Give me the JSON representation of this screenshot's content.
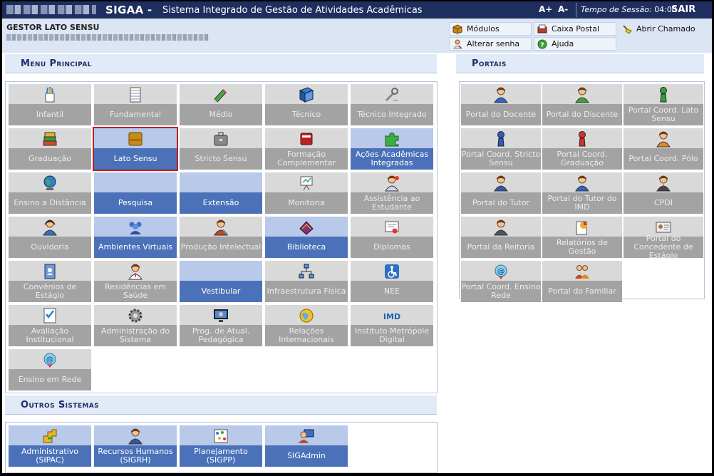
{
  "header": {
    "system_short": "SIGAA -",
    "system_name": "Sistema Integrado de Gestão de Atividades Acadêmicas",
    "font_increase": "A+",
    "font_decrease": "A-",
    "session_label": "Tempo de Sessão:",
    "session_time": "04:00",
    "logout": "SAIR"
  },
  "user": {
    "role": "GESTOR LATO SENSU"
  },
  "actions": {
    "modules": "Módulos",
    "inbox": "Caixa Postal",
    "open_ticket": "Abrir Chamado",
    "change_password": "Alterar senha",
    "help": "Ajuda"
  },
  "menu_principal": {
    "title": "Menu Principal",
    "tiles": [
      {
        "label": "Infantil",
        "icon": "pencils-icon",
        "state": "disabled"
      },
      {
        "label": "Fundamental",
        "icon": "notebook-icon",
        "state": "disabled"
      },
      {
        "label": "Médio",
        "icon": "pencil-icon",
        "state": "disabled"
      },
      {
        "label": "Técnico",
        "icon": "book-icon",
        "state": "disabled"
      },
      {
        "label": "Técnico Integrado",
        "icon": "tools-icon",
        "state": "disabled"
      },
      {
        "label": "Graduação",
        "icon": "books-stack-icon",
        "state": "disabled"
      },
      {
        "label": "Lato Sensu",
        "icon": "folder-icon",
        "state": "active",
        "selected": true
      },
      {
        "label": "Stricto Sensu",
        "icon": "briefcase-icon",
        "state": "disabled"
      },
      {
        "label": "Formação Complementar",
        "icon": "red-book-icon",
        "state": "disabled"
      },
      {
        "label": "Ações Acadêmicas Integradas",
        "icon": "puzzle-icon",
        "state": "active"
      },
      {
        "label": "Ensino a Distância",
        "icon": "globe-icon",
        "state": "disabled"
      },
      {
        "label": "Pesquisa",
        "icon": "",
        "state": "active"
      },
      {
        "label": "Extensão",
        "icon": "",
        "state": "active"
      },
      {
        "label": "Monitoria",
        "icon": "presentation-icon",
        "state": "disabled"
      },
      {
        "label": "Assistência ao Estudante",
        "icon": "support-icon",
        "state": "disabled"
      },
      {
        "label": "Ouvidoria",
        "icon": "headset-icon",
        "state": "disabled"
      },
      {
        "label": "Ambientes Virtuais",
        "icon": "group-icon",
        "state": "active"
      },
      {
        "label": "Produção Intelectual",
        "icon": "author-icon",
        "state": "disabled"
      },
      {
        "label": "Biblioteca",
        "icon": "library-icon",
        "state": "active"
      },
      {
        "label": "Diplomas",
        "icon": "certificate-icon",
        "state": "disabled"
      },
      {
        "label": "Convênios de Estágio",
        "icon": "address-book-icon",
        "state": "disabled"
      },
      {
        "label": "Residências em Saúde",
        "icon": "doctor-icon",
        "state": "disabled"
      },
      {
        "label": "Vestibular",
        "icon": "",
        "state": "active"
      },
      {
        "label": "Infraestrutura Física",
        "icon": "network-icon",
        "state": "disabled"
      },
      {
        "label": "NEE",
        "icon": "wheelchair-icon",
        "state": "disabled"
      },
      {
        "label": "Avaliação Institucional",
        "icon": "checklist-icon",
        "state": "disabled"
      },
      {
        "label": "Administração do Sistema",
        "icon": "gear-icon",
        "state": "disabled"
      },
      {
        "label": "Prog. de Atual. Pedagógica",
        "icon": "monitor-icon",
        "state": "disabled"
      },
      {
        "label": "Relações Internacionais",
        "icon": "world-icon",
        "state": "disabled"
      },
      {
        "label": "Instituto Metrópole Digital",
        "icon": "imd-logo-icon",
        "state": "disabled"
      },
      {
        "label": "Ensino em Rede",
        "icon": "network-at-icon",
        "state": "disabled"
      }
    ]
  },
  "portais": {
    "title": "Portais",
    "tiles": [
      {
        "label": "Portal do Docente",
        "icon": "user-blue-icon"
      },
      {
        "label": "Portal do Discente",
        "icon": "user-green-icon"
      },
      {
        "label": "Portal Coord. Lato Sensu",
        "icon": "user-green-pawn-icon"
      },
      {
        "label": "Portal Coord. Stricto Sensu",
        "icon": "user-blue-pawn-icon"
      },
      {
        "label": "Portal Coord. Graduação",
        "icon": "user-red-pawn-icon"
      },
      {
        "label": "Portal Coord. Pólo",
        "icon": "user-orange-icon"
      },
      {
        "label": "Portal do Tutor",
        "icon": "user-tutor-icon"
      },
      {
        "label": "Portal do Tutor do IMD",
        "icon": "user-tutor-imd-icon"
      },
      {
        "label": "CPDI",
        "icon": "user-suit-icon"
      },
      {
        "label": "Portal da Reitoria",
        "icon": "user-dean-icon"
      },
      {
        "label": "Relatórios de Gestão",
        "icon": "reports-icon"
      },
      {
        "label": "Portal do Concedente de Estágio",
        "icon": "id-card-icon"
      },
      {
        "label": "Portal Coord. Ensino Rede",
        "icon": "network-at-icon"
      },
      {
        "label": "Portal do Familiar",
        "icon": "family-icon"
      }
    ]
  },
  "outros_sistemas": {
    "title": "Outros Sistemas",
    "tiles": [
      {
        "label": "Administrativo (SIPAC)",
        "icon": "puzzle-yellow-icon"
      },
      {
        "label": "Recursos Humanos (SIGRH)",
        "icon": "user-hr-icon"
      },
      {
        "label": "Planejamento (SIGPP)",
        "icon": "planning-icon"
      },
      {
        "label": "SIGAdmin",
        "icon": "admin-icon"
      }
    ]
  }
}
